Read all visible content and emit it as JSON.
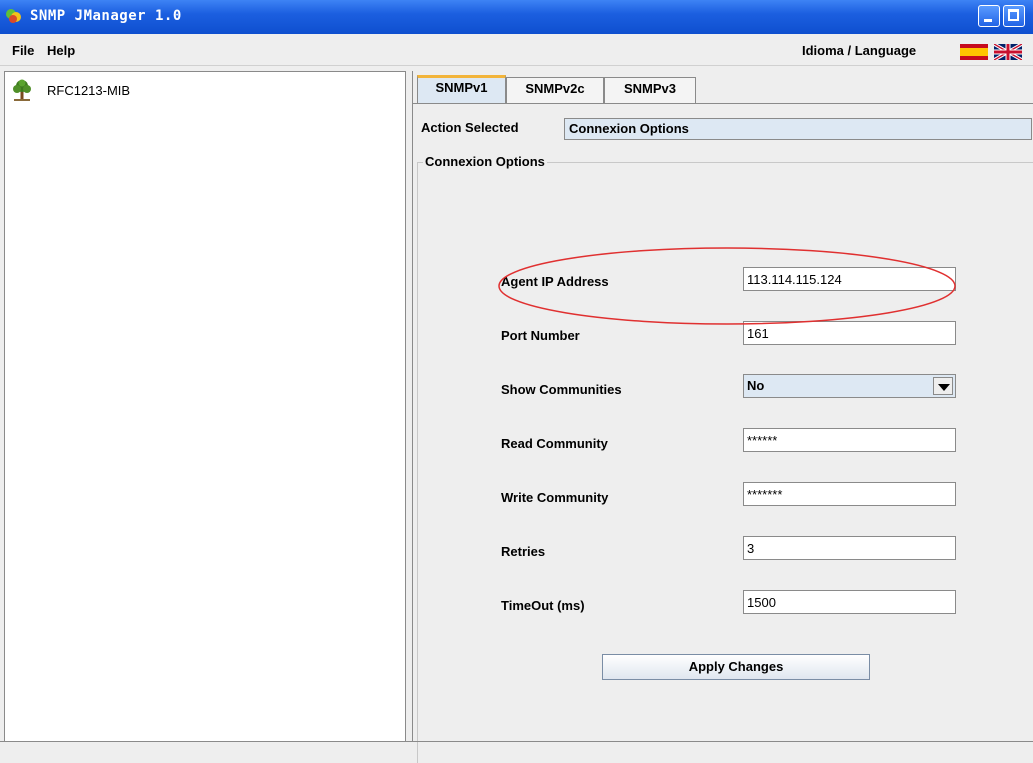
{
  "window": {
    "title": "SNMP JManager 1.0",
    "icon": "app-logo-icon"
  },
  "menu": {
    "file": "File",
    "help": "Help",
    "language_label": "Idioma / Language",
    "flags": [
      "spain-flag-icon",
      "uk-flag-icon"
    ]
  },
  "tree": {
    "root_label": "RFC1213-MIB",
    "root_icon": "tree-icon"
  },
  "tabs": [
    {
      "label": "SNMPv1",
      "active": true
    },
    {
      "label": "SNMPv2c",
      "active": false
    },
    {
      "label": "SNMPv3",
      "active": false
    }
  ],
  "action": {
    "label": "Action Selected",
    "value": "Connexion Options"
  },
  "group_title": "Connexion Options",
  "form": {
    "agent_ip": {
      "label": "Agent IP Address",
      "value": "113.114.115.124"
    },
    "port": {
      "label": "Port Number",
      "value": "161"
    },
    "show_communities": {
      "label": "Show Communities",
      "value": "No"
    },
    "read_community": {
      "label": "Read Community",
      "value": "******"
    },
    "write_community": {
      "label": "Write Community",
      "value": "*******"
    },
    "retries": {
      "label": "Retries",
      "value": "3"
    },
    "timeout": {
      "label": "TimeOut (ms)",
      "value": "1500"
    }
  },
  "apply_button": "Apply Changes",
  "colors": {
    "titlebar": "#1c5fe0",
    "highlight": "#e03030",
    "active_tab_accent": "#f2b43a"
  }
}
